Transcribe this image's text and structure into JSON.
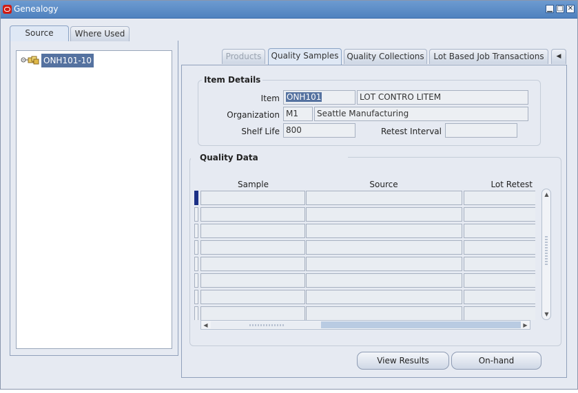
{
  "window": {
    "title": "Genealogy",
    "buttons": {
      "minimize": "▁",
      "maximize": "□",
      "close": "✕"
    }
  },
  "left_tabs": [
    {
      "label": "Source",
      "active": true
    },
    {
      "label": "Where Used",
      "active": false
    }
  ],
  "tree": {
    "node_label": "ONH101-10"
  },
  "right_tabs": [
    {
      "label": "Products",
      "state": "disabled"
    },
    {
      "label": "Quality Samples",
      "state": "active"
    },
    {
      "label": "Quality Collections",
      "state": "normal"
    },
    {
      "label": "Lot Based Job Transactions",
      "state": "normal"
    }
  ],
  "item_details": {
    "title": "Item Details",
    "item_label": "Item",
    "item_value": "ONH101",
    "item_desc": "LOT CONTRO LITEM",
    "org_label": "Organization",
    "org_code": "M1",
    "org_name": "Seattle Manufacturing",
    "shelf_life_label": "Shelf Life",
    "shelf_life_value": "800",
    "retest_label": "Retest Interval",
    "retest_value": ""
  },
  "quality_data": {
    "title": "Quality Data",
    "columns": [
      "Sample",
      "Source",
      "Lot Retest"
    ],
    "row_count": 8
  },
  "buttons": {
    "view_results": "View Results",
    "on_hand": "On-hand"
  },
  "colors": {
    "title_bar": "#4f82bf",
    "selection": "#5572a0",
    "window_bg": "#e6eaf2",
    "current_row": "#1b2f86"
  }
}
